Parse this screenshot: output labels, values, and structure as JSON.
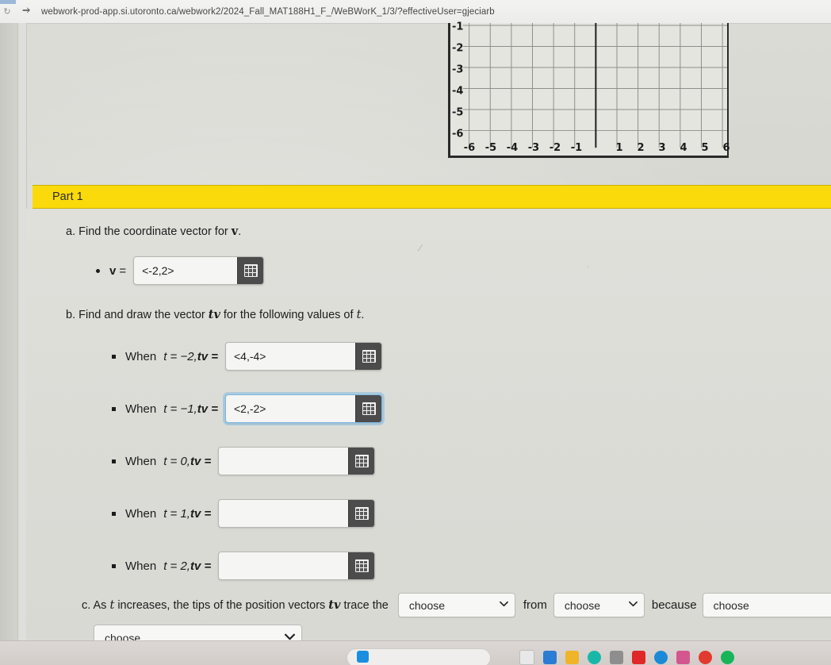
{
  "browser": {
    "url": "webwork-prod-app.si.utoronto.ca/webwork2/2024_Fall_MAT188H1_F_/WeBWorK_1/3/?effectiveUser=gjeciarb",
    "swap_icon": "tab-swap-icon",
    "back_glyph": "↻"
  },
  "graph": {
    "y_ticks": [
      "-1",
      "-2",
      "-3",
      "-4",
      "-5",
      "-6"
    ],
    "x_ticks": [
      "-6",
      "-5",
      "-4",
      "-3",
      "-2",
      "-1",
      "1",
      "2",
      "3",
      "4",
      "5",
      "6"
    ]
  },
  "part": {
    "title": "Part 1"
  },
  "question_a": {
    "prefix": "a. Find the coordinate vector for ",
    "vector": "v",
    "suffix": ".",
    "label_v": "v",
    "label_eq": "=",
    "value": "<-2,2>",
    "placeholder": ""
  },
  "question_b": {
    "prefix": "b. Find and draw the vector ",
    "tv": "tv",
    "mid": " for the following values of ",
    "t": "t",
    "suffix": ".",
    "rows": [
      {
        "when": "When ",
        "t_expr": "t = −2,",
        "tv_expr": " tv =",
        "value": "<4,-4>",
        "focused": false
      },
      {
        "when": "When ",
        "t_expr": "t = −1,",
        "tv_expr": " tv =",
        "value": "<2,-2>",
        "focused": true
      },
      {
        "when": "When ",
        "t_expr": "t = 0,",
        "tv_expr": " tv =",
        "value": "",
        "focused": false
      },
      {
        "when": "When ",
        "t_expr": "t = 1,",
        "tv_expr": " tv =",
        "value": "",
        "focused": false
      },
      {
        "when": "When ",
        "t_expr": "t = 2,",
        "tv_expr": " tv =",
        "value": "",
        "focused": false
      }
    ]
  },
  "question_c": {
    "text_1": "c. As ",
    "var_t": "t",
    "text_2": " increases, the tips of the position vectors ",
    "var_tv": "tv",
    "text_3": " trace the",
    "word_from": "from",
    "word_because": "because",
    "select_1": "choose",
    "select_2": "choose",
    "select_3": "choose",
    "select_4": "choose",
    "caret": "⌄"
  },
  "colors": {
    "banner_yellow": "#fada0a",
    "focus_blue": "#7fb6e0",
    "keypad_dark": "#4c4c4c",
    "page_bg": "#dbdbd6"
  },
  "taskbar": {
    "icons": [
      "start-icon",
      "search-field",
      "widgets-icon",
      "explorer-icon",
      "chrome-icon",
      "store-icon",
      "drop-icon",
      "edit-icon",
      "gift-icon",
      "opera-icon",
      "spotify-icon"
    ]
  }
}
